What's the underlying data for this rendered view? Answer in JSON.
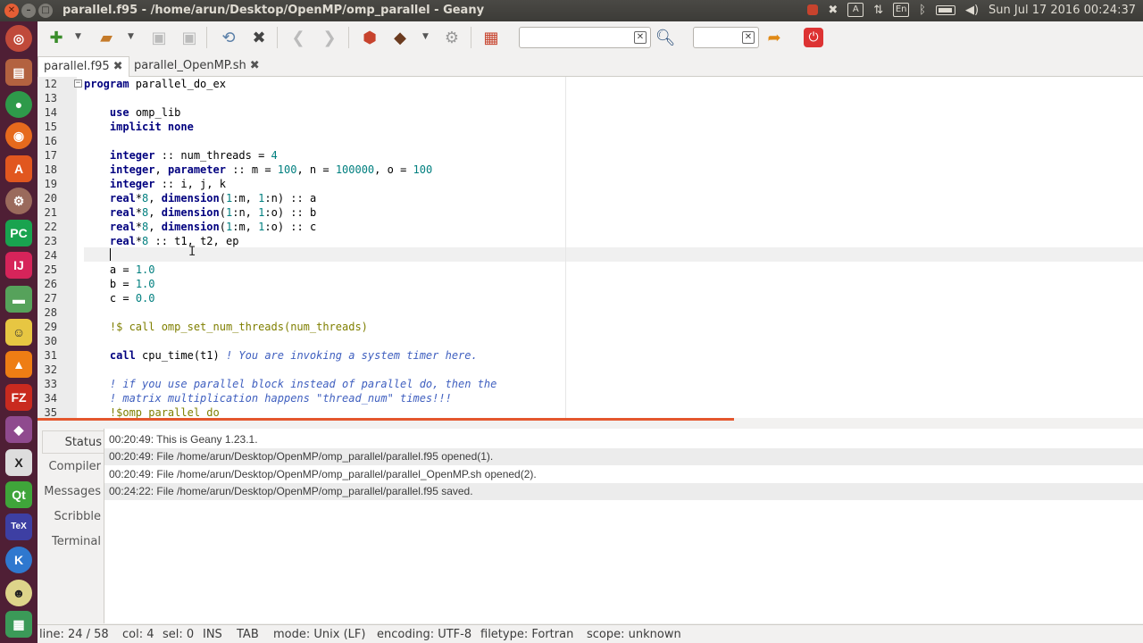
{
  "window": {
    "title": "parallel.f95 - /home/arun/Desktop/OpenMP/omp_parallel - Geany",
    "close": "✕",
    "minimize": "–",
    "maximize": "□"
  },
  "indicators": {
    "keyboard": "En",
    "datetime": "Sun Jul 17 2016 00:24:37"
  },
  "launcher": {
    "items": [
      "dash-icon",
      "files-icon",
      "chrome-icon",
      "firefox-icon",
      "software-center-icon",
      "settings-icon",
      "pycharm-icon",
      "intellij-icon",
      "scanner-icon",
      "gnome-icon",
      "vlc-icon",
      "filezilla-icon",
      "misc-icon",
      "xterm-icon",
      "qt-icon",
      "texmaker-icon",
      "kde-icon",
      "tux-icon",
      "photos-icon"
    ],
    "labels": {
      "chrome": "",
      "pycharm": "PC",
      "intellij": "IJ",
      "filezilla": "FZ",
      "xterm": "X",
      "qt": "Qt",
      "kde": "K"
    }
  },
  "toolbar": {
    "search_value": "",
    "goto_value": ""
  },
  "tabs": [
    {
      "label": "parallel.f95",
      "active": true
    },
    {
      "label": "parallel_OpenMP.sh",
      "active": false
    }
  ],
  "editor": {
    "line_numbers": [
      "12",
      "13",
      "14",
      "15",
      "16",
      "17",
      "18",
      "19",
      "20",
      "21",
      "22",
      "23",
      "24",
      "25",
      "26",
      "27",
      "28",
      "29",
      "30",
      "31",
      "32",
      "33",
      "34",
      "35"
    ]
  },
  "messages": {
    "tabs": [
      "Status",
      "Compiler",
      "Messages",
      "Scribble",
      "Terminal"
    ],
    "lines": [
      "00:20:49: This is Geany 1.23.1.",
      "00:20:49: File /home/arun/Desktop/OpenMP/omp_parallel/parallel.f95 opened(1).",
      "00:20:49: File /home/arun/Desktop/OpenMP/omp_parallel/parallel_OpenMP.sh opened(2).",
      "00:24:22: File /home/arun/Desktop/OpenMP/omp_parallel/parallel.f95 saved."
    ]
  },
  "status": {
    "line": "line: 24 / 58",
    "col": "col: 4",
    "sel": "sel: 0",
    "ins": "INS",
    "tab": "TAB",
    "mode": "mode: Unix (LF)",
    "encoding": "encoding: UTF-8",
    "filetype": "filetype: Fortran",
    "scope": "scope: unknown"
  },
  "code": {
    "l12": {
      "kw": "program",
      "rest": " parallel_do_ex"
    },
    "l14": {
      "kw": "use",
      "rest": " omp_lib"
    },
    "l15": {
      "kw": "implicit none"
    },
    "l17": {
      "kw": "integer",
      "rest": " :: num_threads = ",
      "num": "4"
    },
    "l18": {
      "kw": "integer",
      "a": ", ",
      "kw2": "parameter",
      "b": " :: m = ",
      "n1": "100",
      "c": ", n = ",
      "n2": "100000",
      "d": ", o = ",
      "n3": "100"
    },
    "l19": {
      "kw": "integer",
      "rest": " :: i, j, k"
    },
    "l20": {
      "kw": "real",
      "a": "*",
      "n1": "8",
      "b": ", ",
      "kw2": "dimension",
      "c": "(",
      "n2": "1",
      "d": ":m, ",
      "n3": "1",
      "e": ":n) :: a"
    },
    "l21": {
      "kw": "real",
      "a": "*",
      "n1": "8",
      "b": ", ",
      "kw2": "dimension",
      "c": "(",
      "n2": "1",
      "d": ":n, ",
      "n3": "1",
      "e": ":o) :: b"
    },
    "l22": {
      "kw": "real",
      "a": "*",
      "n1": "8",
      "b": ", ",
      "kw2": "dimension",
      "c": "(",
      "n2": "1",
      "d": ":m, ",
      "n3": "1",
      "e": ":o) :: c"
    },
    "l23": {
      "kw": "real",
      "a": "*",
      "n1": "8",
      "rest": " :: t1, t2, ep"
    },
    "l25": {
      "a": "a = ",
      "n": "1.0"
    },
    "l26": {
      "a": "b = ",
      "n": "1.0"
    },
    "l27": {
      "a": "c = ",
      "n": "0.0"
    },
    "l29": {
      "omp": "!$ call omp_set_num_threads(num_threads)"
    },
    "l31": {
      "kw": "call",
      "rest": " cpu_time(t1) ",
      "cmt": "! You are invoking a system timer here."
    },
    "l33": {
      "cmt": "! if you use parallel block instead of parallel do, then the"
    },
    "l34": {
      "cmt": "! matrix multiplication happens \"thread_num\" times!!!"
    },
    "l35": {
      "omp": "!$omp parallel do"
    }
  }
}
